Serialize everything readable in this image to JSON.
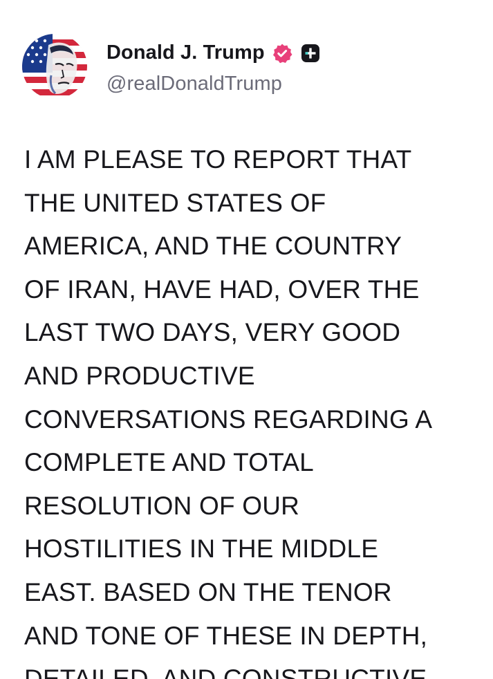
{
  "author": {
    "display_name": "Donald J. Trump",
    "handle": "@realDonaldTrump",
    "verified_icon": "verified-badge-icon",
    "extra_badge_icon": "plus-badge-icon",
    "verified_color": "#e8407a",
    "avatar_icon": "avatar-flag-portrait"
  },
  "post": {
    "lines": [
      "I AM PLEASE TO REPORT THAT",
      "THE UNITED STATES OF",
      "AMERICA, AND THE COUNTRY",
      "OF IRAN, HAVE HAD, OVER THE",
      "LAST TWO DAYS, VERY GOOD",
      "AND PRODUCTIVE",
      "CONVERSATIONS REGARDING A",
      "COMPLETE AND TOTAL",
      "RESOLUTION OF OUR",
      "HOSTILITIES IN THE MIDDLE",
      "EAST. BASED ON THE TENOR",
      "AND TONE OF THESE IN DEPTH,",
      "DETAILED, AND CONSTRUCTIVE"
    ]
  }
}
